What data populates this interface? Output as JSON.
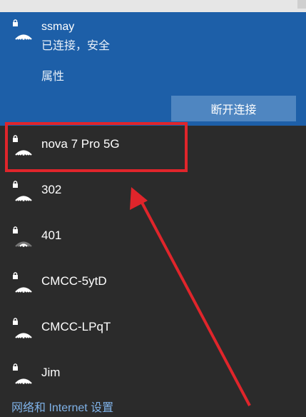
{
  "connected_network": {
    "ssid": "ssmay",
    "status": "已连接，安全",
    "properties_label": "属性",
    "disconnect_label": "断开连接"
  },
  "networks": [
    {
      "ssid": "nova 7 Pro 5G",
      "secured": true,
      "signal": "full"
    },
    {
      "ssid": "302",
      "secured": true,
      "signal": "full"
    },
    {
      "ssid": "401",
      "secured": true,
      "signal": "low"
    },
    {
      "ssid": "CMCC-5ytD",
      "secured": true,
      "signal": "full"
    },
    {
      "ssid": "CMCC-LPqT",
      "secured": true,
      "signal": "full"
    },
    {
      "ssid": "Jim",
      "secured": true,
      "signal": "full"
    }
  ],
  "footer": {
    "settings_link": "网络和 Internet 设置"
  },
  "colors": {
    "panel_bg": "#2b2b2b",
    "connected_bg": "#1d5fa8",
    "button_bg": "#4f86c1",
    "link": "#7fb2e8",
    "annotation": "#e0252b"
  },
  "icons": {
    "network": "wifi-secured-icon"
  }
}
